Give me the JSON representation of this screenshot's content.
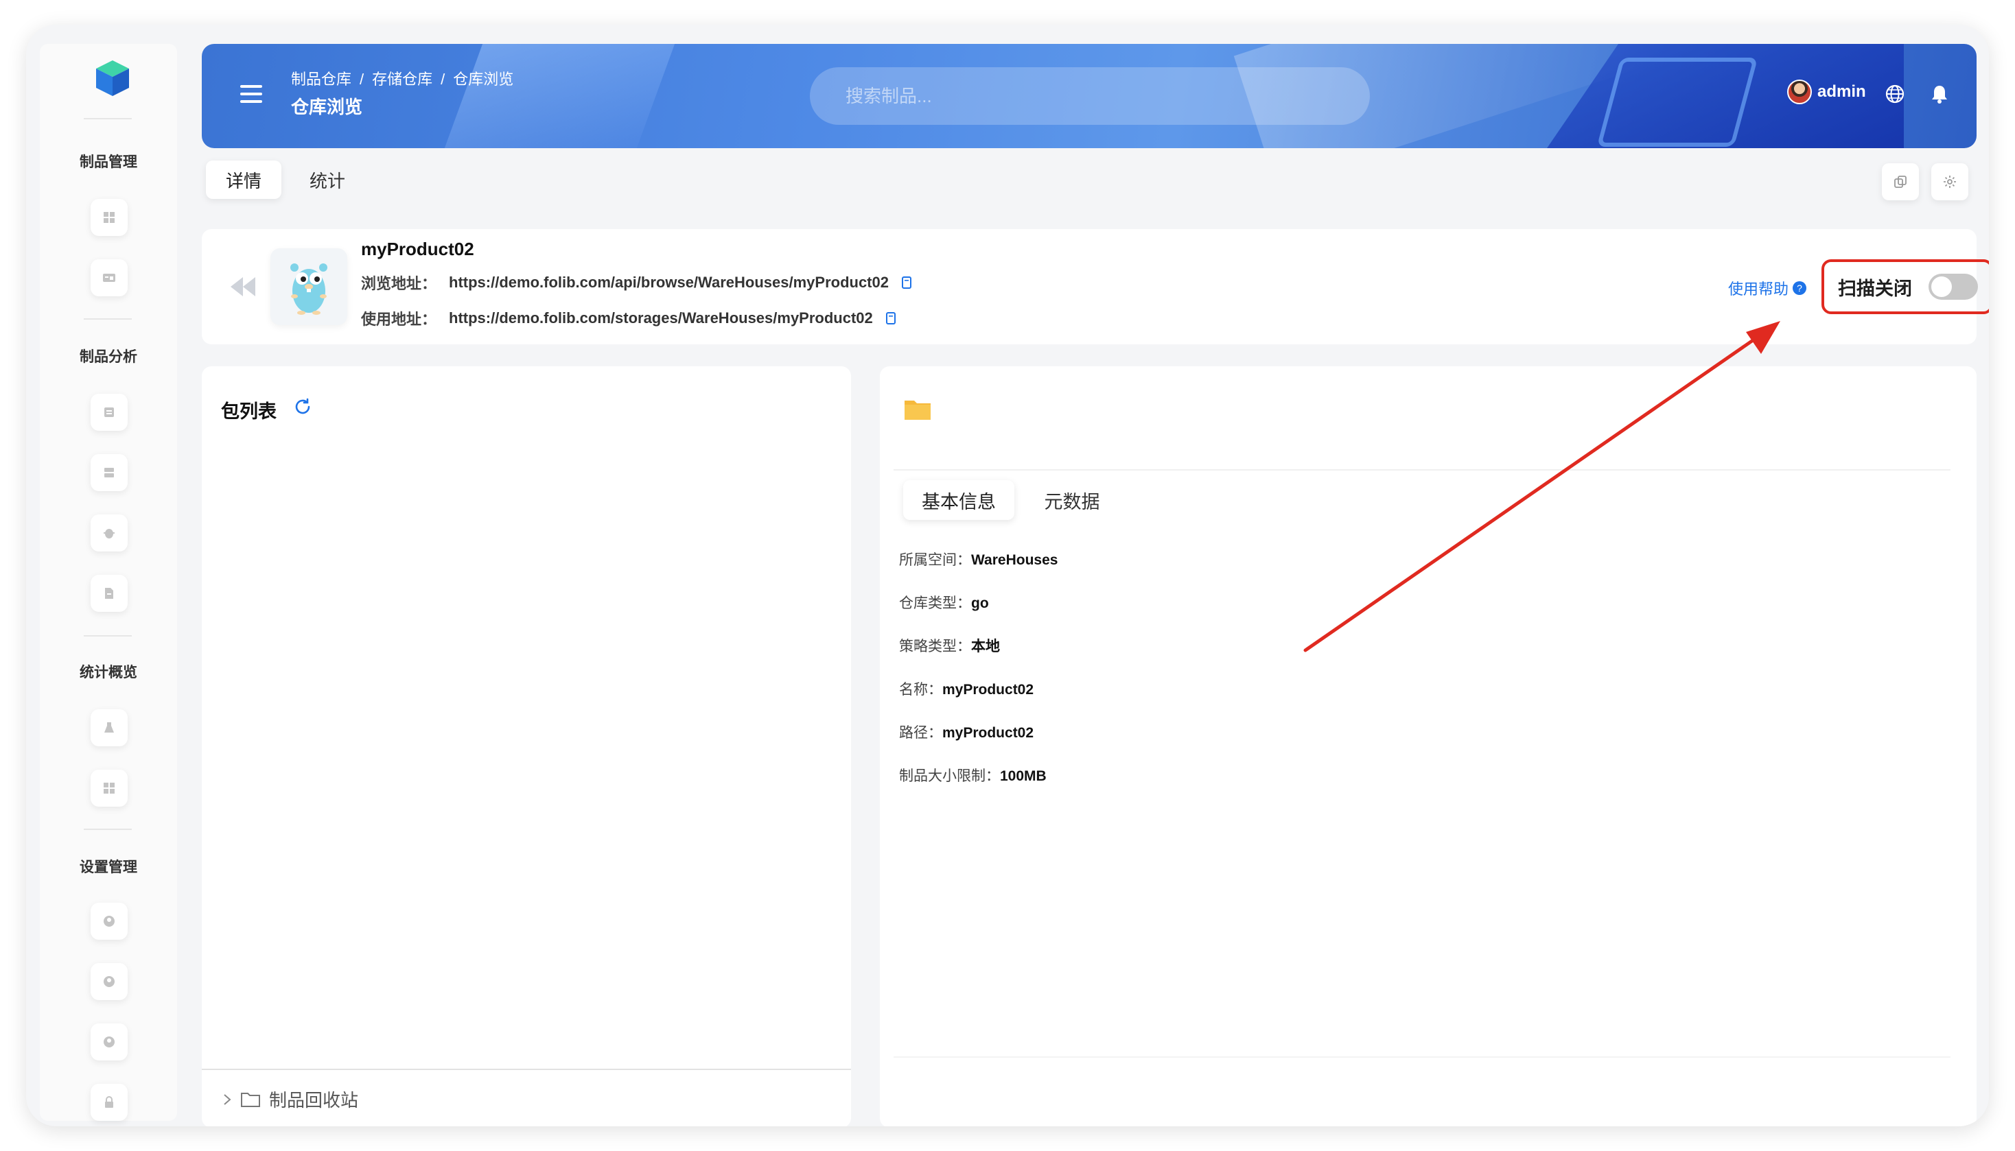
{
  "sidebar": {
    "sections": [
      {
        "title": "制品管理",
        "items": [
          {
            "icon": "grid-icon"
          },
          {
            "icon": "card-icon"
          }
        ]
      },
      {
        "title": "制品分析",
        "items": [
          {
            "icon": "list-icon"
          },
          {
            "icon": "server-icon"
          },
          {
            "icon": "bug-icon"
          },
          {
            "icon": "doc-icon"
          }
        ]
      },
      {
        "title": "统计概览",
        "items": [
          {
            "icon": "flask-icon"
          },
          {
            "icon": "grid-icon"
          }
        ]
      },
      {
        "title": "设置管理",
        "items": [
          {
            "icon": "user-icon"
          },
          {
            "icon": "user-icon"
          },
          {
            "icon": "user-icon"
          },
          {
            "icon": "lock-icon"
          }
        ]
      }
    ]
  },
  "header": {
    "breadcrumb": [
      "制品仓库",
      "存储仓库",
      "仓库浏览"
    ],
    "breadcrumb_sep": "/",
    "title": "仓库浏览",
    "search_placeholder": "搜索制品...",
    "user": "admin"
  },
  "tabs": {
    "detail": "详情",
    "stats": "统计"
  },
  "product": {
    "name": "myProduct02",
    "browse_label": "浏览地址：",
    "browse_url": "https://demo.folib.com/api/browse/WareHouses/myProduct02",
    "usage_label": "使用地址：",
    "usage_url": "https://demo.folib.com/storages/WareHouses/myProduct02",
    "help": "使用帮助",
    "help_mark": "?",
    "scan_label": "扫描关闭",
    "scan_enabled": false
  },
  "packages": {
    "title": "包列表",
    "recycle": "制品回收站"
  },
  "info": {
    "tabs": [
      "基本信息",
      "元数据"
    ],
    "fields": [
      {
        "label": "所属空间：",
        "value": "WareHouses"
      },
      {
        "label": "仓库类型：",
        "value": "go"
      },
      {
        "label": "策略类型：",
        "value": "本地"
      },
      {
        "label": "名称：",
        "value": "myProduct02"
      },
      {
        "label": "路径：",
        "value": "myProduct02"
      },
      {
        "label": "制品大小限制：",
        "value": "100MB"
      }
    ]
  },
  "colors": {
    "accent": "#1e73e8",
    "annotation": "#e02a20",
    "header": "#4f8ae6"
  }
}
